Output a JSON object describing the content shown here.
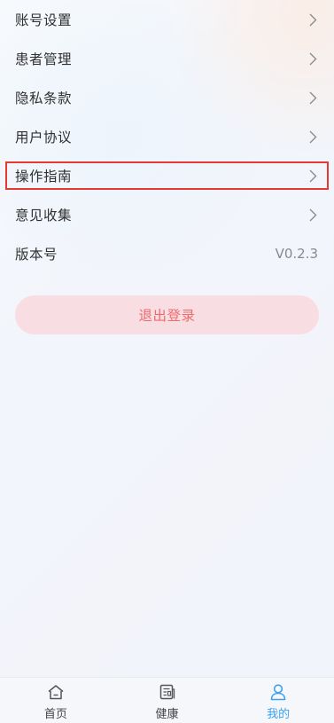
{
  "menu": {
    "items": [
      {
        "label": "账号设置",
        "type": "link"
      },
      {
        "label": "患者管理",
        "type": "link"
      },
      {
        "label": "隐私条款",
        "type": "link"
      },
      {
        "label": "用户协议",
        "type": "link"
      },
      {
        "label": "操作指南",
        "type": "link",
        "highlighted": true
      },
      {
        "label": "意见收集",
        "type": "link"
      },
      {
        "label": "版本号",
        "type": "value",
        "value": "V0.2.3"
      }
    ]
  },
  "logout": {
    "label": "退出登录"
  },
  "tabbar": {
    "tabs": [
      {
        "label": "首页",
        "icon": "home-icon",
        "active": false
      },
      {
        "label": "健康",
        "icon": "health-record-icon",
        "active": false
      },
      {
        "label": "我的",
        "icon": "user-icon",
        "active": true
      }
    ]
  },
  "colors": {
    "highlight_border": "#e53a33",
    "logout_bg": "#f8dde2",
    "logout_text": "#ee6b6b",
    "active_tab": "#3aa2f0"
  }
}
